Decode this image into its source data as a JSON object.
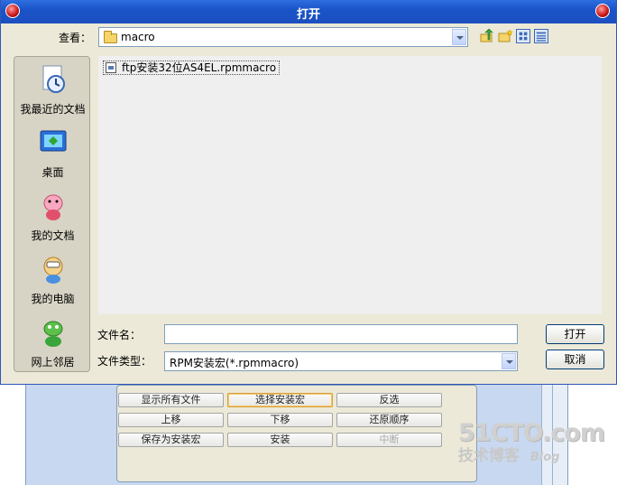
{
  "dialog": {
    "title": "打开",
    "look_in_label": "查看：",
    "look_in_value": "macro",
    "places": [
      {
        "label": "我最近的文档",
        "icon": "recent-documents-icon"
      },
      {
        "label": "桌面",
        "icon": "desktop-icon"
      },
      {
        "label": "我的文档",
        "icon": "my-documents-icon"
      },
      {
        "label": "我的电脑",
        "icon": "my-computer-icon"
      },
      {
        "label": "网上邻居",
        "icon": "network-places-icon"
      }
    ],
    "files": [
      {
        "name": "ftp安装32位AS4EL.rpmmacro",
        "icon": "rpmmacro-file-icon"
      }
    ],
    "filename_label": "文件名：",
    "filename_value": "",
    "filetype_label": "文件类型：",
    "filetype_value": "RPM安装宏(*.rpmmacro)",
    "open_label": "打开",
    "cancel_label": "取消"
  },
  "background_app": {
    "buttons": [
      {
        "label": "显示所有文件",
        "state": "normal"
      },
      {
        "label": "选择安装宏",
        "state": "selected"
      },
      {
        "label": "反选",
        "state": "normal"
      },
      {
        "label": "上移",
        "state": "normal"
      },
      {
        "label": "下移",
        "state": "normal"
      },
      {
        "label": "还原顺序",
        "state": "normal"
      },
      {
        "label": "保存为安装宏",
        "state": "normal"
      },
      {
        "label": "安装",
        "state": "normal"
      },
      {
        "label": "中断",
        "state": "disabled"
      }
    ]
  },
  "watermark": {
    "main": "51CTO.com",
    "sub": "技术博客",
    "blog": "Blog"
  },
  "colors": {
    "titlebar": "#1a54c8",
    "dialog_bg": "#ece9d8",
    "list_bg": "#efefef",
    "border": "#7f9db9"
  }
}
